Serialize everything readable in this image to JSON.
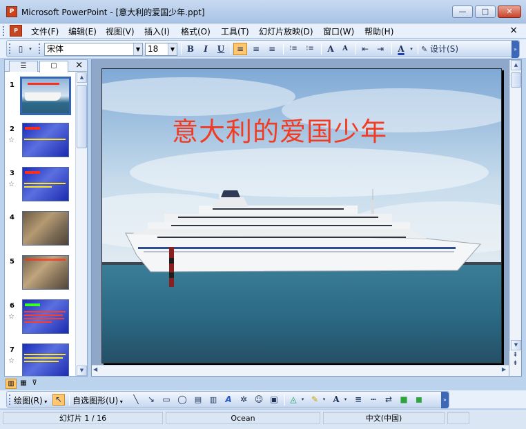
{
  "window": {
    "app_icon": "P",
    "title": "Microsoft PowerPoint - [意大利的爱国少年.ppt]",
    "minimize": "—",
    "maximize": "□",
    "close": "✕"
  },
  "menubar": {
    "doc_icon": "P",
    "items": [
      "文件(F)",
      "编辑(E)",
      "视图(V)",
      "插入(I)",
      "格式(O)",
      "工具(T)",
      "幻灯片放映(D)",
      "窗口(W)",
      "帮助(H)"
    ],
    "close": "×"
  },
  "toolbar": {
    "font_name": "宋体",
    "font_size": "18",
    "bold": "B",
    "italic": "I",
    "underline": "U",
    "align_left": "≡",
    "align_center": "≡",
    "align_right": "≡",
    "numbering": "⁝≡",
    "bullets": "⁝≡",
    "grow_font": "A",
    "shrink_font": "A",
    "decrease_indent": "⇤",
    "increase_indent": "⇥",
    "font_color": "A",
    "design_label": "设计(S)"
  },
  "panel": {
    "tab_outline": "☰",
    "tab_slides": "▢",
    "close": "×",
    "slides": [
      {
        "num": "1",
        "star": "",
        "kind": "photo"
      },
      {
        "num": "2",
        "star": "☆",
        "kind": "blue"
      },
      {
        "num": "3",
        "star": "☆",
        "kind": "blue"
      },
      {
        "num": "4",
        "star": "",
        "kind": "art"
      },
      {
        "num": "5",
        "star": "",
        "kind": "art"
      },
      {
        "num": "6",
        "star": "☆",
        "kind": "blue"
      },
      {
        "num": "7",
        "star": "☆",
        "kind": "blue"
      }
    ]
  },
  "slide": {
    "title": "意大利的爱国少年"
  },
  "drawbar": {
    "draw_label": "绘图(R)",
    "autoshapes_label": "自选图形(U)"
  },
  "status": {
    "slide_info": "幻灯片 1 / 16",
    "design": "Ocean",
    "language": "中文(中国)"
  },
  "colors": {
    "title_red": "#f23b23",
    "selection_blue": "#3166b6",
    "active_button": "#ffc870"
  }
}
